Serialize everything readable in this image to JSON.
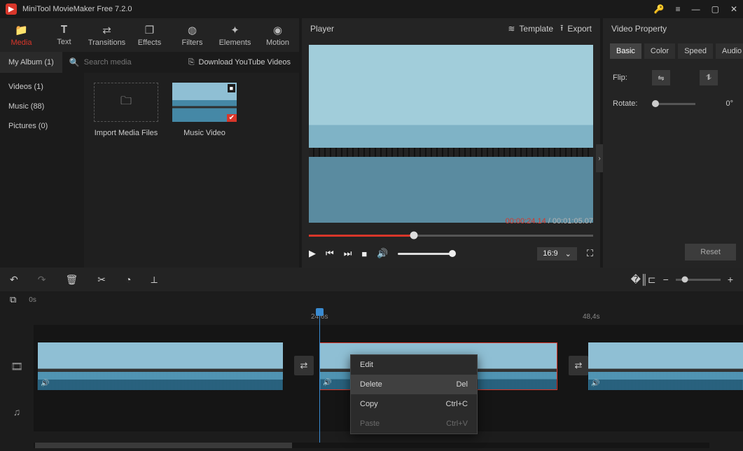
{
  "app": {
    "title": "MiniTool MovieMaker Free 7.2.0"
  },
  "tabs": {
    "media": "Media",
    "text": "Text",
    "transitions": "Transitions",
    "effects": "Effects",
    "filters": "Filters",
    "elements": "Elements",
    "motion": "Motion"
  },
  "library": {
    "my_album": "My Album (1)",
    "search_placeholder": "Search media",
    "download": "Download YouTube Videos",
    "side": {
      "videos": "Videos (1)",
      "music": "Music (88)",
      "pictures": "Pictures (0)"
    },
    "import_label": "Import Media Files",
    "clip_label": "Music Video"
  },
  "player": {
    "title": "Player",
    "template": "Template",
    "export": "Export",
    "cur_time": "00:00:24.14",
    "total_time": "00:01:05.07",
    "aspect": "16:9"
  },
  "props": {
    "title": "Video Property",
    "tabs": {
      "basic": "Basic",
      "color": "Color",
      "speed": "Speed",
      "audio": "Audio"
    },
    "flip": "Flip:",
    "rotate": "Rotate:",
    "rotate_val": "0°",
    "reset": "Reset"
  },
  "timeline": {
    "marks": {
      "m0": "0s",
      "m1": "24,6s",
      "m2": "48,4s"
    }
  },
  "ctx": {
    "edit": "Edit",
    "delete": "Delete",
    "delete_key": "Del",
    "copy": "Copy",
    "copy_key": "Ctrl+C",
    "paste": "Paste",
    "paste_key": "Ctrl+V"
  }
}
